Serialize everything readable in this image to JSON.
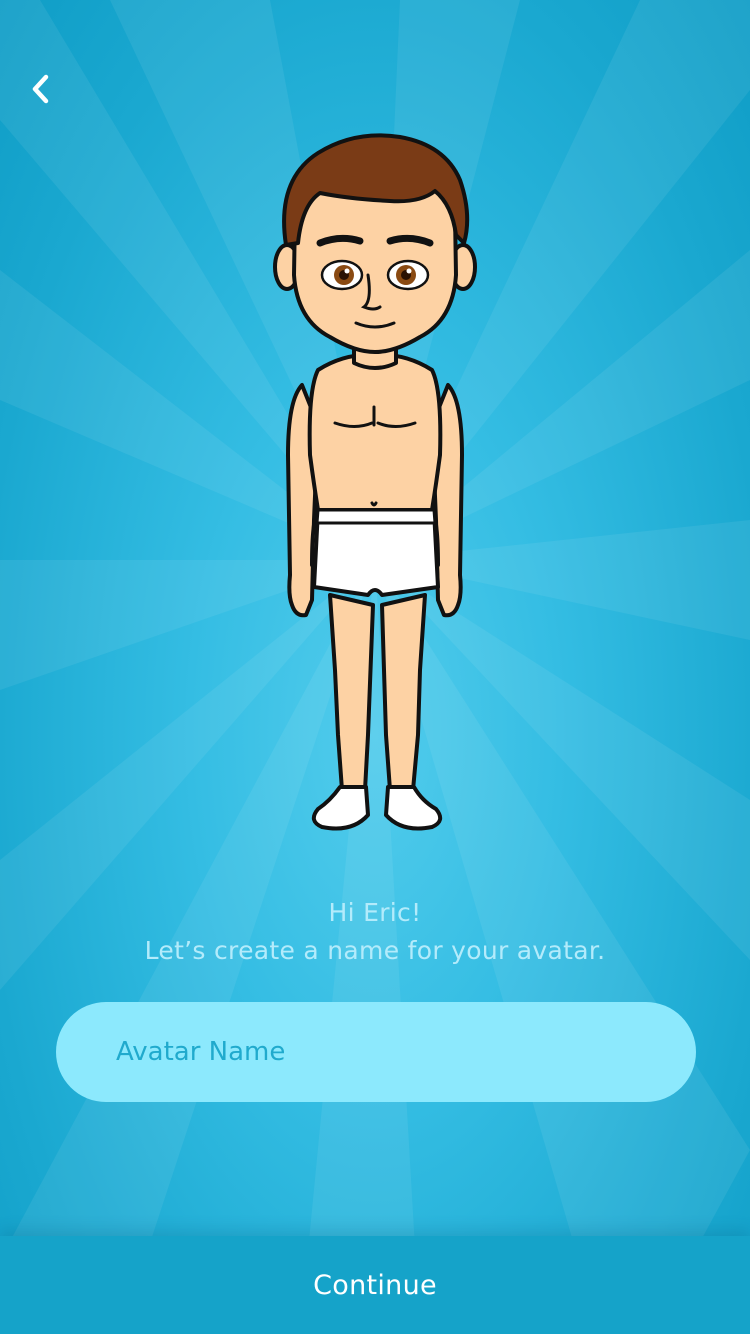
{
  "header": {
    "back_icon": "chevron-left-icon"
  },
  "avatar": {
    "description_icon": "avatar-figure"
  },
  "greeting": {
    "line1": "Hi Eric!",
    "line2": "Let’s create a name for your avatar."
  },
  "name_input": {
    "placeholder": "Avatar Name",
    "value": ""
  },
  "footer": {
    "continue_label": "Continue"
  },
  "colors": {
    "background": "#34bde3",
    "input_bg": "#8ce9fd",
    "footer_bg": "#15a3c9",
    "greeting_text": "#b3ebfb"
  }
}
